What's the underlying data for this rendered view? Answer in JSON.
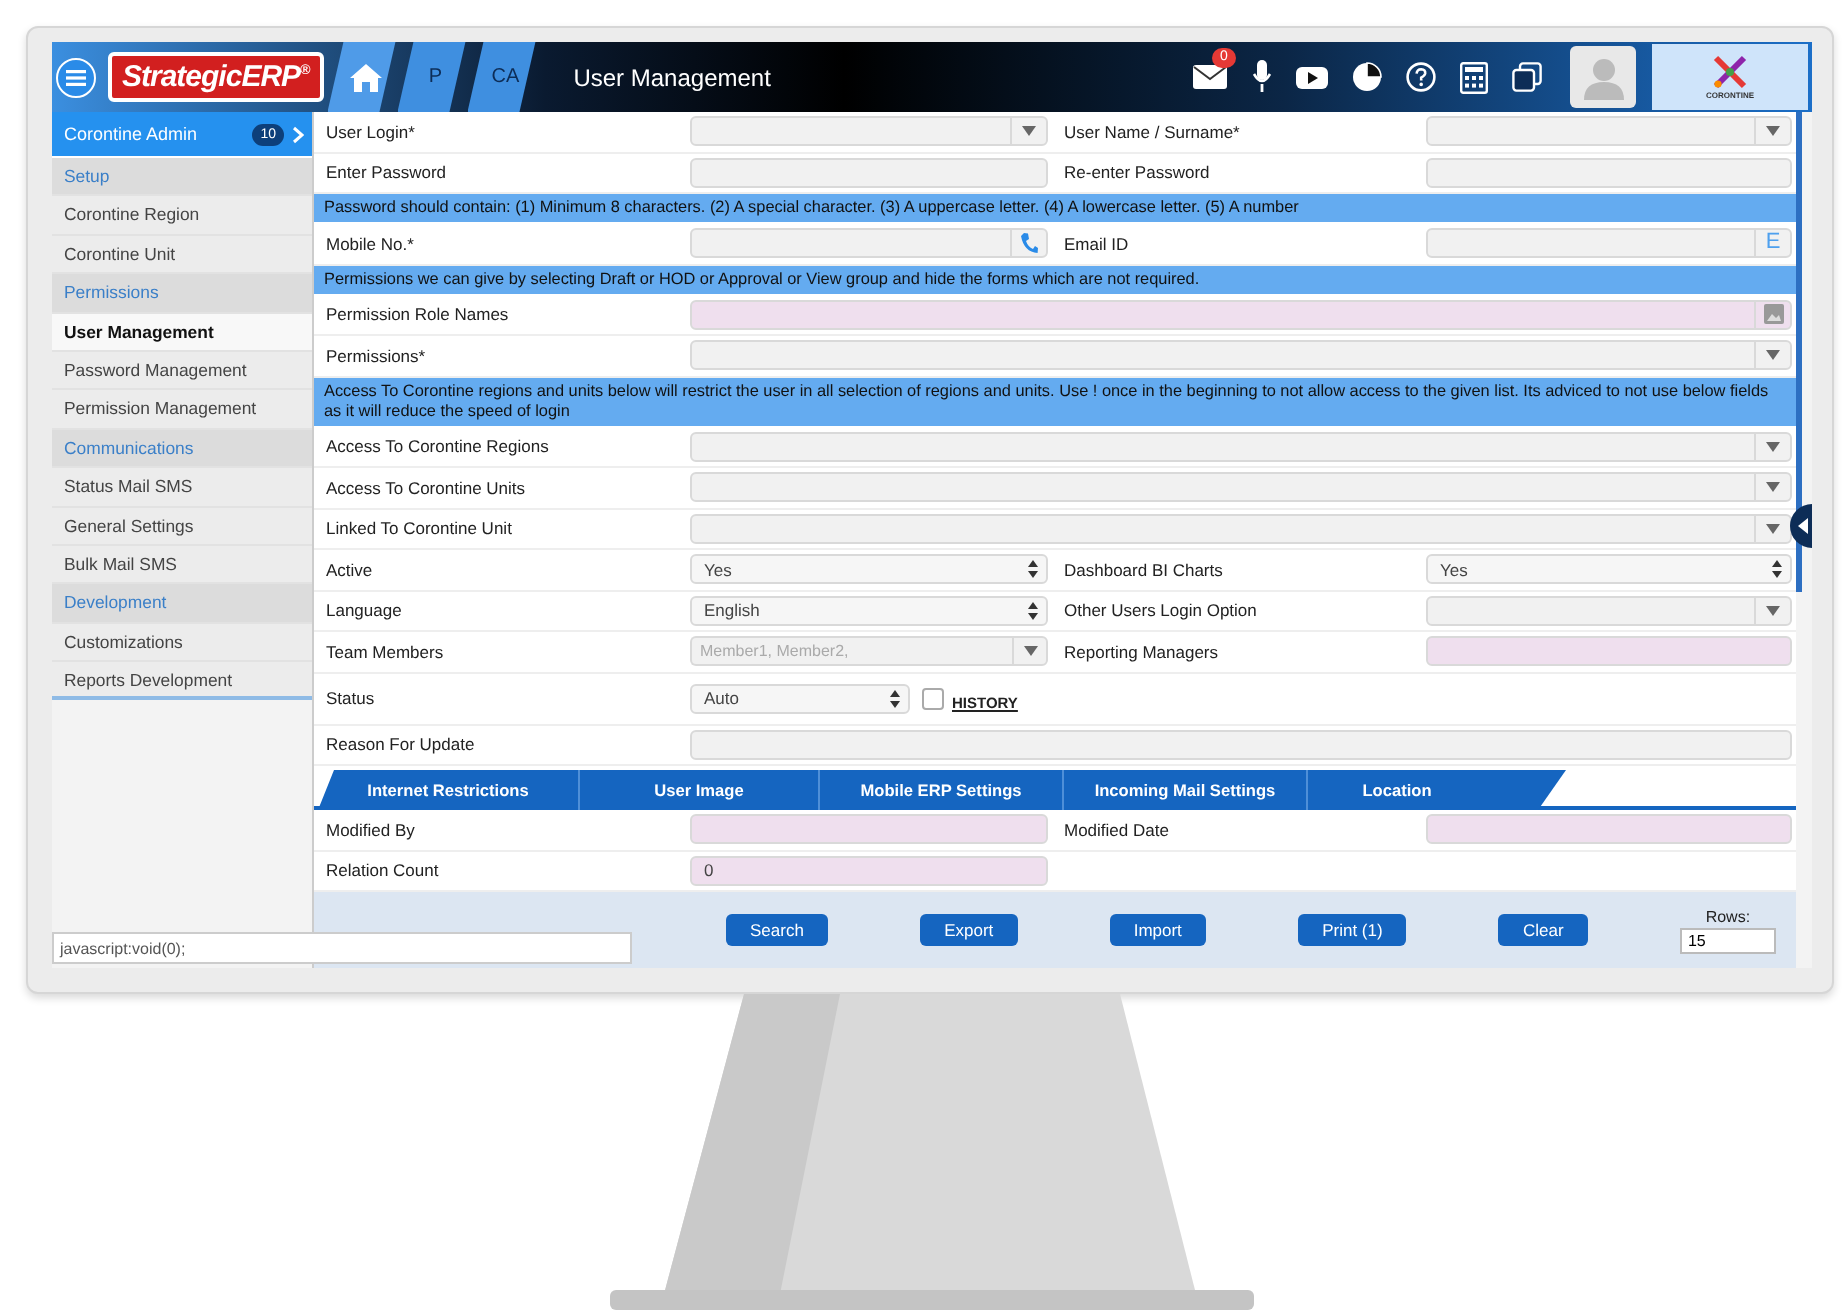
{
  "header": {
    "logo": "StrategicERP$^{®}$",
    "breadcrumbs": [
      "P",
      "CA"
    ],
    "title": "User Management",
    "mail_badge": "0",
    "brand_caption": "CORONTINE"
  },
  "sidebar": {
    "title": "Corontine Admin",
    "badge": "10",
    "items": [
      {
        "label": "Setup",
        "kind": "group",
        "selected": false
      },
      {
        "label": "Corontine Region",
        "kind": "link",
        "selected": false
      },
      {
        "label": "Corontine Unit",
        "kind": "link",
        "selected": false
      },
      {
        "label": "Permissions",
        "kind": "group",
        "selected": false
      },
      {
        "label": "User Management",
        "kind": "link",
        "selected": true
      },
      {
        "label": "Password Management",
        "kind": "link",
        "selected": false
      },
      {
        "label": "Permission Management",
        "kind": "link",
        "selected": false
      },
      {
        "label": "Communications",
        "kind": "group",
        "selected": false
      },
      {
        "label": "Status Mail SMS",
        "kind": "link",
        "selected": false
      },
      {
        "label": "General Settings",
        "kind": "link",
        "selected": false
      },
      {
        "label": "Bulk Mail SMS",
        "kind": "link",
        "selected": false
      },
      {
        "label": "Development",
        "kind": "group",
        "selected": false
      },
      {
        "label": "Customizations",
        "kind": "link",
        "selected": false
      },
      {
        "label": "Reports Development",
        "kind": "link",
        "selected": false
      }
    ]
  },
  "form": {
    "rows": [
      {
        "kind": "pair",
        "fields": [
          {
            "label": "User Login*",
            "kind": "select",
            "readonly": false
          },
          {
            "label": "User Name / Surname*",
            "kind": "select",
            "readonly": false
          }
        ]
      },
      {
        "kind": "pair",
        "fields": [
          {
            "label": "Enter Password",
            "kind": "text",
            "readonly": false
          },
          {
            "label": "Re-enter Password",
            "kind": "text",
            "readonly": false
          }
        ]
      },
      {
        "kind": "note",
        "text": "Password should contain: (1) Minimum 8 characters. (2) A special character. (3) A uppercase letter. (4) A lowercase letter. (5) A number"
      },
      {
        "kind": "pair",
        "fields": [
          {
            "label": "Mobile No.*",
            "kind": "phone",
            "readonly": false
          },
          {
            "label": "Email ID",
            "kind": "email",
            "addon": "E",
            "readonly": false
          }
        ]
      },
      {
        "kind": "note",
        "text": "Permissions we can give by selecting Draft or HOD or Approval or View group and hide the forms which are not required."
      },
      {
        "kind": "wide",
        "fields": [
          {
            "label": "Permission Role Names",
            "kind": "image",
            "readonly": true
          }
        ]
      },
      {
        "kind": "wide",
        "fields": [
          {
            "label": "Permissions*",
            "kind": "select",
            "readonly": false
          }
        ]
      },
      {
        "kind": "note",
        "text": "Access To Corontine regions and units below will restrict the user in all selection of regions and units. Use ! once in the beginning to not allow access to the given list. Its adviced to not use below fields as it will reduce the speed of login"
      },
      {
        "kind": "wide",
        "fields": [
          {
            "label": "Access To Corontine Regions",
            "kind": "select",
            "readonly": false
          }
        ]
      },
      {
        "kind": "wide",
        "fields": [
          {
            "label": "Access To Corontine Units",
            "kind": "select",
            "readonly": false
          }
        ]
      },
      {
        "kind": "wide",
        "fields": [
          {
            "label": "Linked To Corontine Unit",
            "kind": "select",
            "readonly": false
          }
        ]
      },
      {
        "kind": "pair",
        "fields": [
          {
            "label": "Active",
            "kind": "spinner",
            "value": "Yes",
            "readonly": false
          },
          {
            "label": "Dashboard BI Charts",
            "kind": "spinner",
            "value": "Yes",
            "readonly": false
          }
        ]
      },
      {
        "kind": "pair",
        "fields": [
          {
            "label": "Language",
            "kind": "spinner",
            "value": "English",
            "readonly": false
          },
          {
            "label": "Other Users Login Option",
            "kind": "select",
            "readonly": false
          }
        ]
      },
      {
        "kind": "pair",
        "fields": [
          {
            "label": "Team Members",
            "kind": "combo",
            "placeholder": "Member1, Member2,",
            "readonly": false
          },
          {
            "label": "Reporting Managers",
            "kind": "text",
            "readonly": true
          }
        ]
      },
      {
        "kind": "status",
        "label": "Status",
        "field": {
          "kind": "spinner",
          "value": "Auto",
          "readonly": false
        },
        "checked": false,
        "link": "HISTORY"
      },
      {
        "kind": "wide",
        "fields": [
          {
            "label": "Reason For Update",
            "kind": "text",
            "readonly": false
          }
        ]
      },
      {
        "kind": "tabs",
        "tabs": [
          "Internet Restrictions",
          "User Image",
          "Mobile ERP Settings",
          "Incoming Mail Settings",
          "Location"
        ]
      },
      {
        "kind": "pair",
        "fields": [
          {
            "label": "Modified By",
            "kind": "text",
            "readonly": true
          },
          {
            "label": "Modified Date",
            "kind": "text",
            "readonly": true
          }
        ]
      },
      {
        "kind": "single",
        "fields": [
          {
            "label": "Relation Count",
            "kind": "text",
            "value": "0",
            "readonly": true
          }
        ]
      },
      {
        "kind": "actions",
        "buttons": [
          "Search",
          "Export",
          "Import",
          "Print (1)",
          "Clear"
        ],
        "rows_label": "Rows:",
        "rows_value": "15"
      }
    ]
  },
  "status_url": "javascript:void(0);"
}
